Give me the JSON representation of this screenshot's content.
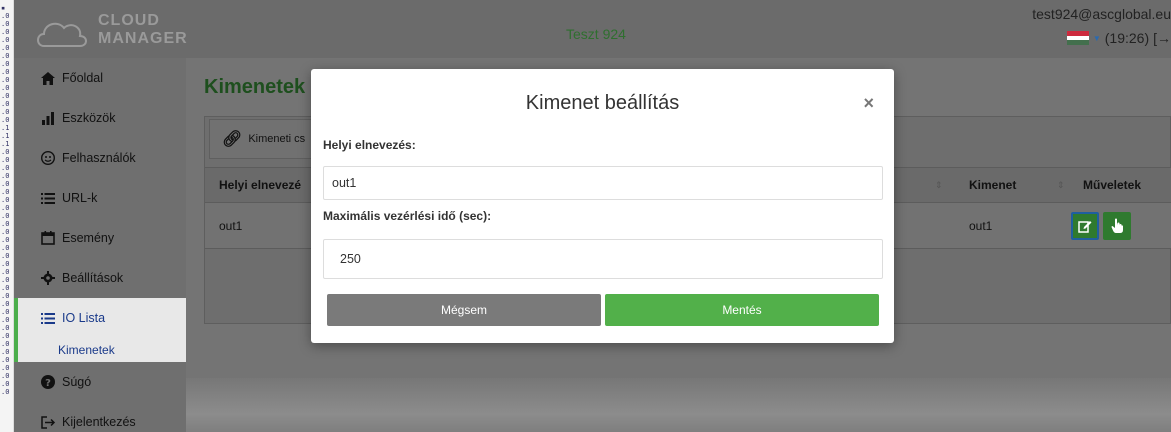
{
  "header": {
    "logo_line1": "CLOUD",
    "logo_line2": "MANAGER",
    "title": "Teszt 924",
    "user_email": "test924@ascglobal.eu",
    "time": "(19:26)",
    "language_flag": "flag-hu-icon"
  },
  "sidebar": {
    "items": [
      {
        "label": "Főoldal",
        "icon": "home-icon"
      },
      {
        "label": "Eszközök",
        "icon": "bar-chart-icon"
      },
      {
        "label": "Felhasználók",
        "icon": "users-icon"
      },
      {
        "label": "URL-k",
        "icon": "list-icon"
      },
      {
        "label": "Esemény",
        "icon": "calendar-icon"
      },
      {
        "label": "Beállítások",
        "icon": "gear-icon"
      },
      {
        "label": "IO Lista",
        "icon": "list-icon"
      },
      {
        "label": "Kimenetek",
        "icon": ""
      },
      {
        "label": "Súgó",
        "icon": "question-icon"
      },
      {
        "label": "Kijelentkezés",
        "icon": "logout-icon"
      }
    ]
  },
  "main": {
    "page_title": "Kimenetek",
    "panel_heading": "Kimeneti cs",
    "table": {
      "headers": [
        "Helyi elnevezé",
        "Kimenet",
        "Műveletek"
      ],
      "rows": [
        {
          "name": "out1",
          "output": "out1"
        }
      ]
    }
  },
  "modal": {
    "title": "Kimenet beállítás",
    "close": "×",
    "name_label": "Helyi elnevezés:",
    "name_value": "out1",
    "time_label": "Maximális vezérlési idő (sec):",
    "time_value": "250",
    "cancel_label": "Mégsem",
    "save_label": "Mentés"
  },
  "colors": {
    "accent_green": "#52b04a",
    "title_green": "#1e4f1e",
    "cancel_gray": "#7a7a7a"
  }
}
